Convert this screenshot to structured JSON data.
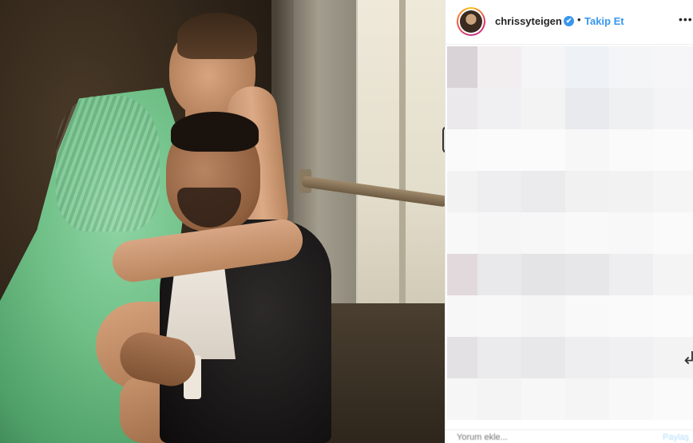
{
  "post": {
    "username": "chrissyteigen",
    "verified_mark": "✔",
    "separator": "•",
    "follow_label": "Takip Et",
    "more_label": "•••",
    "comment_placeholder": "Yorum ekle...",
    "share_label": "Paylaş"
  },
  "icons": {
    "avatar": "profile-avatar",
    "verified": "verified-badge-icon",
    "more": "more-options-icon",
    "cursor": "mouse-cursor-icon"
  },
  "colors": {
    "link_blue": "#3897f0",
    "text_dark": "#262626",
    "muted": "#8e8e8e"
  }
}
